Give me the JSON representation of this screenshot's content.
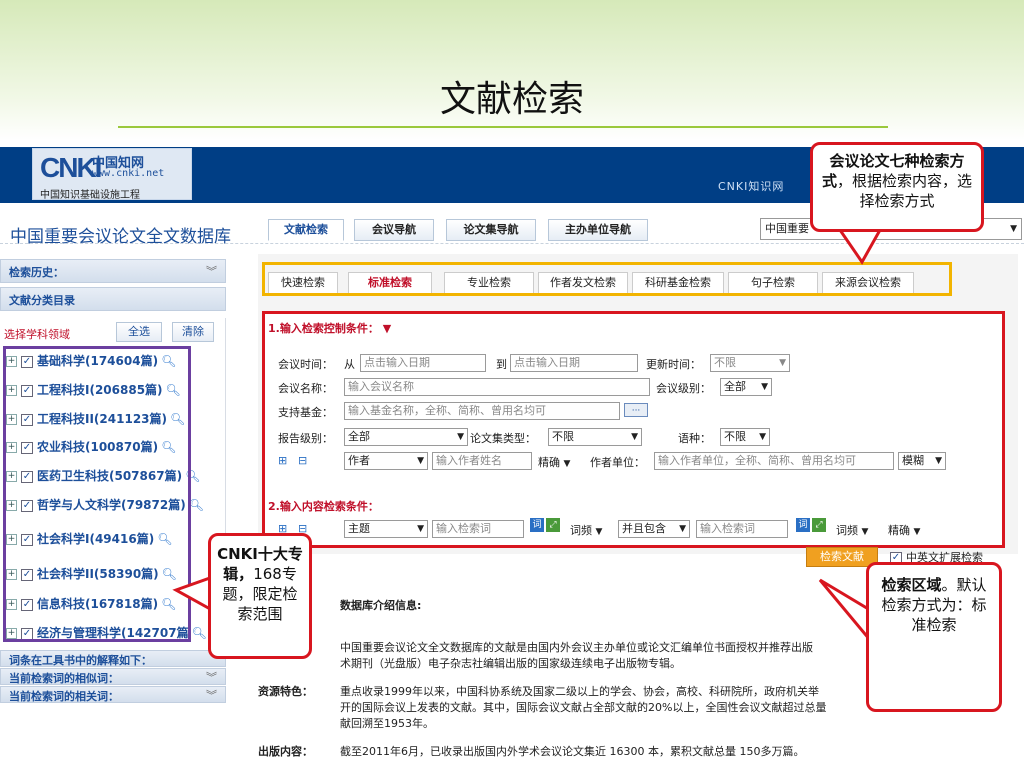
{
  "slide": {
    "title": "文献检索"
  },
  "banner": {
    "logo_mark": "CNKI",
    "logo_cn": "中国知网",
    "logo_url": "www.cnki.net",
    "logo_sub": "中国知识基础设施工程",
    "right_text": "CNKI知识网"
  },
  "db": {
    "title": "中国重要会议论文全文数据库",
    "tabs": [
      "文献检索",
      "会议导航",
      "论文集导航",
      "主办单位导航"
    ],
    "selector_value": "中国重要"
  },
  "sidebar": {
    "history": "检索历史：",
    "category_dir": "文献分类目录",
    "subject_label": "选择学科领域",
    "select_all": "全选",
    "clear": "清除",
    "subjects": [
      "基础科学(174604篇)",
      "工程科技I(206885篇)",
      "工程科技II(241123篇)",
      "农业科技(100870篇)",
      "医药卫生科技(507867篇)",
      "哲学与人文科学(79872篇)",
      "社会科学I(49416篇)",
      "社会科学II(58390篇)",
      "信息科技(167818篇)",
      "经济与管理科学(142707篇"
    ],
    "bottom_bars": [
      "词条在工具书中的解释如下：",
      "当前检索词的相似词：",
      "当前检索词的相关词："
    ]
  },
  "search_tabs": [
    "快速检索",
    "标准检索",
    "专业检索",
    "作者发文检索",
    "科研基金检索",
    "句子检索",
    "来源会议检索"
  ],
  "control": {
    "heading": "1.输入检索控制条件：",
    "meeting_time_label": "会议时间：",
    "from": "从",
    "date_placeholder": "点击输入日期",
    "to": "到",
    "update_label": "更新时间：",
    "update_value": "不限",
    "meeting_name_label": "会议名称：",
    "meeting_name_placeholder": "输入会议名称",
    "level_label": "会议级别：",
    "level_value": "全部",
    "fund_label": "支持基金：",
    "fund_placeholder": "输入基金名称，全称、简称、曾用名均可",
    "report_label": "报告级别：",
    "report_value": "全部",
    "proc_type_label": "论文集类型：",
    "proc_type_value": "不限",
    "lang_label": "语种：",
    "lang_value": "不限",
    "author_field": "作者",
    "author_placeholder": "输入作者姓名",
    "precise": "精确",
    "author_unit_label": "作者单位：",
    "author_unit_placeholder": "输入作者单位，全称、简称、曾用名均可",
    "fuzzy": "模糊"
  },
  "content": {
    "heading": "2.输入内容检索条件：",
    "field": "主题",
    "keyword_placeholder": "输入检索词",
    "freq": "词频",
    "and_op": "并且包含",
    "precise": "精确",
    "search_button": "检索文献",
    "ext_label": "中英文扩展检索"
  },
  "info": {
    "heading": "数据库介绍信息:",
    "para1": "中国重要会议论文全文数据库的文献是由国内外会议主办单位或论文汇编单位书面授权并推荐出版",
    "para1b": "术期刊（光盘版）电子杂志社编辑出版的国家级连续电子出版物专辑。",
    "res_label": "资源特色：",
    "res_text": "重点收录1999年以来，中国科协系统及国家二级以上的学会、协会，高校、科研院所，政府机关举",
    "res_text2": "开的国际会议上发表的文献。其中，国际会议文献占全部文献的20%以上，全国性会议文献超过总量",
    "res_text3": "献回溯至1953年。",
    "pub_label": "出版内容：",
    "pub_text": "截至2011年6月，已收录出版国内外学术会议论文集近 16300 本，累积文献总量 150多万篇。"
  },
  "callouts": {
    "top_bold": "会议论文七种检索方式",
    "top_rest": "，根据检索内容，选择检索方式",
    "left_bold": "CNKI十大专辑，",
    "left_rest": "168专题，限定检索范围",
    "right_bold": "检索区域",
    "right_rest": "。默认检索方式为：标准检索"
  },
  "colors": {
    "accent": "#d8161f",
    "brand": "#1d4f9a",
    "orange": "#f2b400",
    "purple": "#6b3fa0"
  }
}
